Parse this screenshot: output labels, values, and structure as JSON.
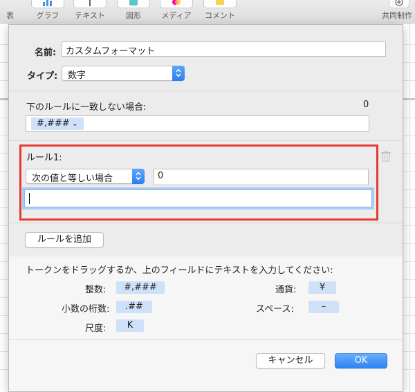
{
  "toolbar": {
    "items": [
      {
        "label": "表"
      },
      {
        "label": "グラフ"
      },
      {
        "label": "テキスト"
      },
      {
        "label": "図形"
      },
      {
        "label": "メディア"
      },
      {
        "label": "コメント"
      },
      {
        "label": "共同制作"
      }
    ]
  },
  "dialog": {
    "name_label": "名前:",
    "name_value": "カスタムフォーマット",
    "type_label": "タイプ:",
    "type_value": "数字",
    "default_rule_label": "下のルールに一致しない場合:",
    "default_rule_count": "0",
    "default_token": "#,###",
    "rule": {
      "title": "ルール1:",
      "condition": "次の値と等しい場合",
      "value": "0",
      "format_value": ""
    },
    "add_rule_button": "ルールを追加",
    "tokens_instruction": "トークンをドラッグするか、上のフィールドにテキストを入力してください:",
    "tokens": [
      {
        "label": "整数:",
        "token": "#,###"
      },
      {
        "label": "小数の桁数:",
        "token": ".##"
      },
      {
        "label": "尺度:",
        "token": "K"
      },
      {
        "label": "通貨:",
        "token": "¥"
      },
      {
        "label": "スペース:",
        "token": "–"
      }
    ],
    "cancel_button": "キャンセル",
    "ok_button": "OK"
  },
  "colors": {
    "highlight_border": "#e53a31",
    "accent": "#3183f4",
    "token_bg": "#cfe1f8"
  }
}
